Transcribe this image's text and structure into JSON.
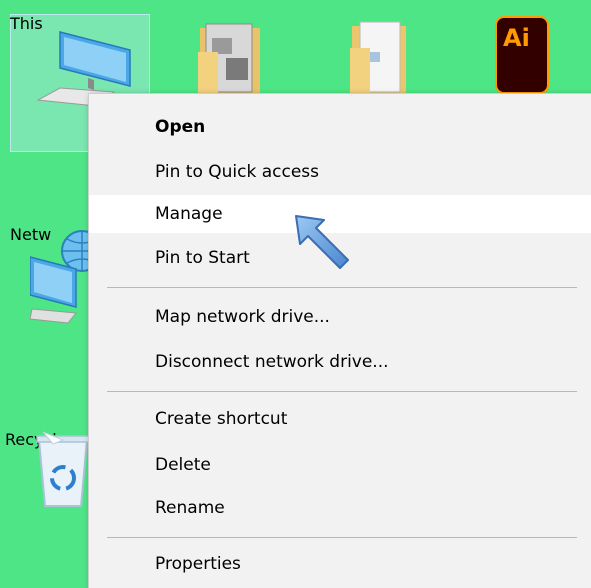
{
  "desktop": {
    "icons": [
      {
        "name": "this-pc",
        "label": "This",
        "icon": "computer-icon",
        "selected": true
      },
      {
        "name": "network",
        "label": "Netw",
        "icon": "network-icon"
      },
      {
        "name": "recycle-bin",
        "label": "Recycl",
        "icon": "recycle-bin-icon"
      },
      {
        "name": "folder-1",
        "label": "",
        "icon": "folder-icon"
      },
      {
        "name": "folder-2",
        "label": "",
        "icon": "folder-icon"
      },
      {
        "name": "illustrator",
        "label": "",
        "icon": "adobe-illustrator-icon",
        "icon_text": "Ai"
      }
    ]
  },
  "context_menu": {
    "items": [
      {
        "label": "Open",
        "bold": true
      },
      {
        "label": "Pin to Quick access"
      },
      {
        "label": "Manage",
        "hovered": true
      },
      {
        "label": "Pin to Start"
      },
      {
        "label": "Map network drive..."
      },
      {
        "label": "Disconnect network drive..."
      },
      {
        "label": "Create shortcut"
      },
      {
        "label": "Delete"
      },
      {
        "label": "Rename"
      },
      {
        "label": "Properties"
      }
    ]
  },
  "pointer": {
    "icon": "arrow-pointer-icon",
    "color": "#6fa8e8"
  },
  "colors": {
    "desktop_background": "#4ee586",
    "menu_background": "#f2f2f2",
    "menu_hover": "#ffffff"
  }
}
